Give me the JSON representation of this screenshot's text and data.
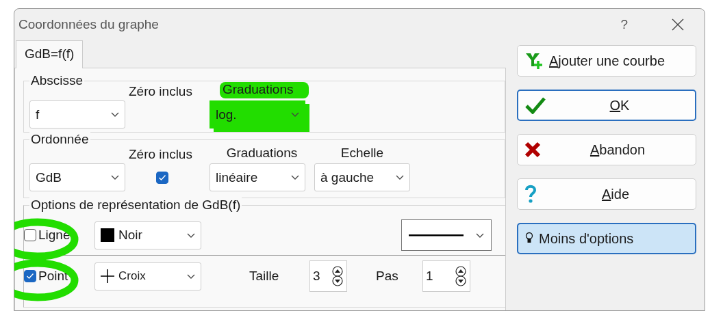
{
  "window": {
    "title": "Coordonnées du graphe",
    "help": "?"
  },
  "tabs": [
    {
      "label": "GdB=f(f)",
      "selected": true
    }
  ],
  "abscisse": {
    "legend": "Abscisse",
    "variable": "f",
    "zero_label": "Zéro inclus",
    "graduations_label": "Graduations",
    "graduations_label_highlighted": true,
    "graduations": "log.",
    "graduations_highlighted": true
  },
  "ordonnee": {
    "legend": "Ordonnée",
    "variable": "GdB",
    "zero_label": "Zéro inclus",
    "zero_checked": true,
    "graduations_label": "Graduations",
    "graduations": "linéaire",
    "echelle_label": "Echelle",
    "echelle": "à gauche"
  },
  "options": {
    "legend": "Options de représentation de GdB(f)",
    "rows": [
      {
        "kind": "line",
        "label": "Ligne",
        "checked": false,
        "circled": true,
        "color_name": "Noir",
        "color": "#000000"
      },
      {
        "kind": "point",
        "label": "Point",
        "checked": true,
        "circled": true,
        "marker": "Croix",
        "size_label": "Taille",
        "size": "3",
        "step_label": "Pas",
        "step": "1"
      }
    ]
  },
  "buttons": [
    {
      "kind": "add",
      "label": "Ajouter une courbe",
      "underline_first": true,
      "focused": false
    },
    {
      "kind": "ok",
      "label": "OK",
      "underline_first": true,
      "focused": true
    },
    {
      "kind": "cancel",
      "label": "Abandon",
      "underline_first": true,
      "focused": false
    },
    {
      "kind": "help",
      "label": "Aide",
      "underline_first": true,
      "focused": false
    },
    {
      "kind": "less",
      "label": "Moins d'options",
      "underline_first": false,
      "focused": true
    }
  ]
}
